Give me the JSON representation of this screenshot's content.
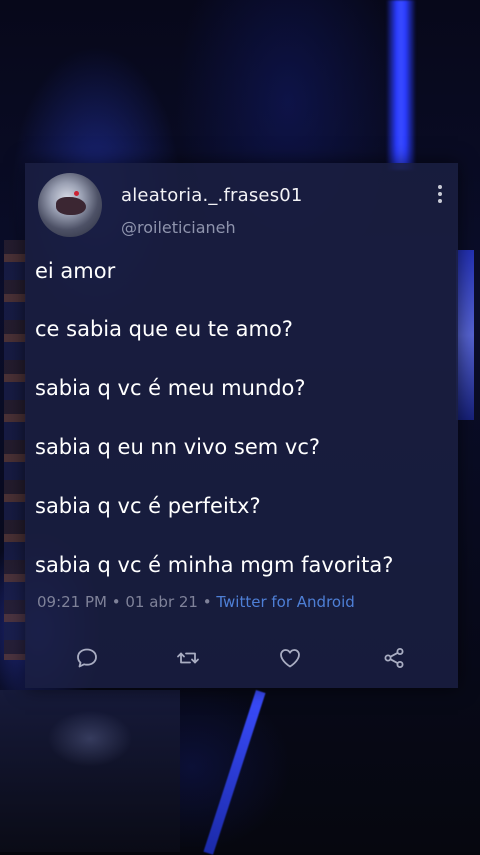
{
  "tweet": {
    "username": "aleatoria._.frases01",
    "handle": "@roileticianeh",
    "lines": [
      "ei amor",
      "ce sabia que eu te amo?",
      "sabia q vc é meu mundo?",
      "sabia q eu nn vivo sem vc?",
      "sabia q vc é perfeitx?",
      "sabia q vc é minha mgm favorita?"
    ],
    "time": "09:21 PM",
    "date": "01 abr 21",
    "separator": " • ",
    "app": "Twitter for Android"
  },
  "icons": {
    "more": "more-vertical-icon",
    "reply": "reply-icon",
    "retweet": "retweet-icon",
    "like": "heart-icon",
    "share": "share-icon"
  },
  "colors": {
    "card_bg": "#1a1e40",
    "text": "#ffffff",
    "muted": "#7f8299",
    "link": "#4e7fd6",
    "beam": "#2a3cff"
  }
}
